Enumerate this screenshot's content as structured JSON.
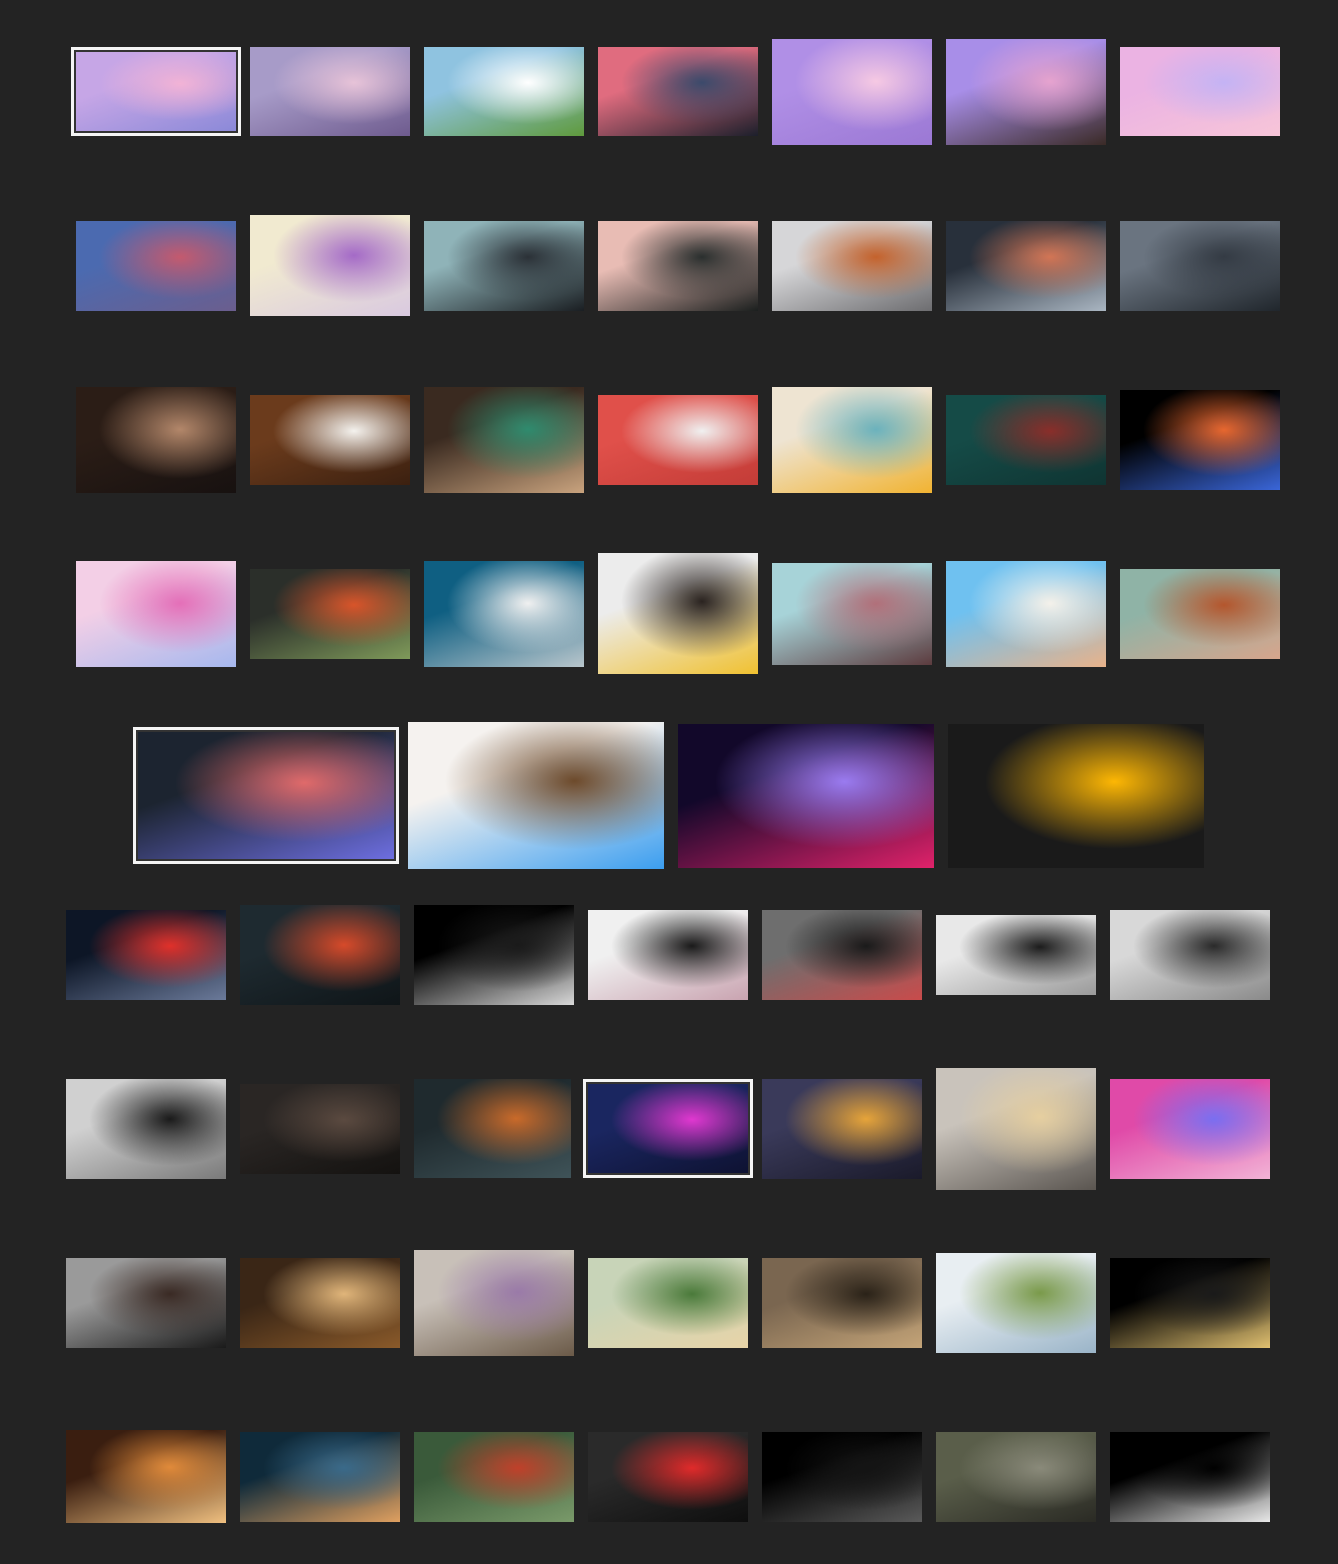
{
  "gallery": {
    "title": "",
    "rows": [
      {
        "thumbs": [
          {
            "name": "thumb-pastel-clouds-moon",
            "selected": true,
            "colors": [
              "#c6a6e6",
              "#f2b3d6",
              "#8b89d8"
            ]
          },
          {
            "name": "thumb-pink-cloudy-sky",
            "colors": [
              "#a79bc8",
              "#e7c3d8",
              "#6e5b8e"
            ]
          },
          {
            "name": "thumb-anime-cloud-hill",
            "colors": [
              "#8fc3e0",
              "#ffffff",
              "#5f9a3c"
            ]
          },
          {
            "name": "thumb-city-pink-sunset",
            "colors": [
              "#e06c7f",
              "#3b4a6b",
              "#1c1f2b"
            ]
          },
          {
            "name": "thumb-cherry-blossom",
            "colors": [
              "#b08fe6",
              "#f6c9e3",
              "#9b78d4"
            ]
          },
          {
            "name": "thumb-purple-dusk-mountain",
            "colors": [
              "#a88ee8",
              "#e6a3cf",
              "#3a2a26"
            ]
          },
          {
            "name": "thumb-cat-on-clouds",
            "colors": [
              "#ebb3e3",
              "#c4b3f4",
              "#f7c5d8"
            ]
          }
        ]
      },
      {
        "thumbs": [
          {
            "name": "thumb-train-station",
            "colors": [
              "#4b6ab0",
              "#c45a6e",
              "#6b5e8e"
            ]
          },
          {
            "name": "thumb-purple-mist-peak",
            "colors": [
              "#f1ead0",
              "#a46ac7",
              "#d9c9e0"
            ]
          },
          {
            "name": "thumb-dark-mountains-teal",
            "colors": [
              "#8fb3b8",
              "#2b3137",
              "#1a1e22"
            ]
          },
          {
            "name": "thumb-pink-sky-peak",
            "colors": [
              "#e8bcb4",
              "#2a2f2e",
              "#1b1f1e"
            ]
          },
          {
            "name": "thumb-orange-ridge-fog",
            "colors": [
              "#d6d6d8",
              "#c4622c",
              "#6d6d70"
            ]
          },
          {
            "name": "thumb-abstract-orange-shapes",
            "colors": [
              "#28303b",
              "#d27555",
              "#aab6c2"
            ]
          },
          {
            "name": "thumb-foggy-forest",
            "colors": [
              "#6a7480",
              "#343b44",
              "#20262c"
            ]
          }
        ]
      },
      {
        "thumbs": [
          {
            "name": "thumb-latte-art-dark",
            "colors": [
              "#2b1d16",
              "#b3876a",
              "#171110"
            ]
          },
          {
            "name": "thumb-coffee-beans-cup",
            "colors": [
              "#6b3b1c",
              "#f4f2ee",
              "#3b2010"
            ]
          },
          {
            "name": "thumb-green-cup-latte",
            "colors": [
              "#3a2a20",
              "#2f8b6e",
              "#c9a37e"
            ]
          },
          {
            "name": "thumb-red-wall-outlets",
            "colors": [
              "#e0504a",
              "#f0f0f0",
              "#c33c37"
            ]
          },
          {
            "name": "thumb-striped-building",
            "colors": [
              "#eee4d2",
              "#6bb2bd",
              "#f1b331"
            ]
          },
          {
            "name": "thumb-dalek",
            "colors": [
              "#154b47",
              "#8a2e2a",
              "#0f3432"
            ]
          },
          {
            "name": "thumb-liquid-swirl",
            "colors": [
              "#000000",
              "#e7672f",
              "#3a66d9"
            ]
          }
        ]
      },
      {
        "thumbs": [
          {
            "name": "thumb-pink-marble",
            "colors": [
              "#f3cfe6",
              "#e46fb8",
              "#a6b8ee"
            ]
          },
          {
            "name": "thumb-autumn-forest-lake",
            "colors": [
              "#2b2f2a",
              "#d8542a",
              "#7f9a5a"
            ]
          },
          {
            "name": "thumb-blue-sky-white-roof",
            "colors": [
              "#0f5f82",
              "#f0f0f0",
              "#b9c6cc"
            ]
          },
          {
            "name": "thumb-triangle-building",
            "colors": [
              "#ececec",
              "#2a2320",
              "#f0c130"
            ]
          },
          {
            "name": "thumb-pink-cubes-building",
            "colors": [
              "#a7d3d8",
              "#b1707a",
              "#5c3b3e"
            ]
          },
          {
            "name": "thumb-white-house-blue-sky",
            "colors": [
              "#6fc1f0",
              "#f4f1ea",
              "#e8b28a"
            ]
          },
          {
            "name": "thumb-orange-tower-up",
            "colors": [
              "#8fb3a6",
              "#b4562d",
              "#d7a58c"
            ]
          }
        ]
      },
      {
        "thumbs": [
          {
            "name": "thumb-neon-skeleton-logo",
            "selected": true,
            "colors": [
              "#1c2430",
              "#e06a6a",
              "#6d6ee0"
            ]
          },
          {
            "name": "thumb-anime-silver-hair-logo",
            "colors": [
              "#f5f2ef",
              "#6d4a2b",
              "#3b9ef0"
            ]
          },
          {
            "name": "thumb-purple-gradient-logo",
            "colors": [
              "#12082a",
              "#9a7bf0",
              "#e0226a"
            ]
          },
          {
            "name": "thumb-black-yellow-split",
            "colors": [
              "#1a1a1a",
              "#fdb704",
              "#1a1a1a"
            ]
          }
        ]
      },
      {
        "thumbs": [
          {
            "name": "thumb-darth-vader-saber",
            "colors": [
              "#0d1626",
              "#e0302a",
              "#6b7a9a"
            ]
          },
          {
            "name": "thumb-red-rings-abstract",
            "colors": [
              "#1e2a30",
              "#d64a2a",
              "#0f1518"
            ]
          },
          {
            "name": "thumb-black-bear-dark",
            "colors": [
              "#000000",
              "#1a1a1a",
              "#d8d8d8"
            ]
          },
          {
            "name": "thumb-anime-white-hair-girl",
            "colors": [
              "#f0f0f0",
              "#1a1a1a",
              "#c9a3b0"
            ]
          },
          {
            "name": "thumb-girl-red-symbols",
            "colors": [
              "#6e6e6e",
              "#1a1a1a",
              "#c94b4b"
            ]
          },
          {
            "name": "thumb-manga-pattern",
            "colors": [
              "#e8e8e8",
              "#1c1c1c",
              "#9a9a9a"
            ]
          },
          {
            "name": "thumb-silhouettes-fists",
            "colors": [
              "#d8d8d8",
              "#2a2a2a",
              "#8a8a8a"
            ]
          }
        ]
      },
      {
        "thumbs": [
          {
            "name": "thumb-bw-girl-fence",
            "colors": [
              "#d0d0d0",
              "#1a1a1a",
              "#7a7a7a"
            ]
          },
          {
            "name": "thumb-girl-with-rifle",
            "colors": [
              "#2a2624",
              "#5b4a40",
              "#141210"
            ]
          },
          {
            "name": "thumb-girl-smoking-cap",
            "colors": [
              "#1f2a2e",
              "#c96a2a",
              "#3f5358"
            ]
          },
          {
            "name": "thumb-neon-flower-girl",
            "selected": true,
            "colors": [
              "#1a2660",
              "#e038d0",
              "#0e1232"
            ]
          },
          {
            "name": "thumb-curly-hair-bokeh",
            "colors": [
              "#3a3a5a",
              "#e6a43a",
              "#1a1a2a"
            ]
          },
          {
            "name": "thumb-blonde-bob-girl",
            "colors": [
              "#c9c3bb",
              "#e6cfa0",
              "#5a5550"
            ]
          },
          {
            "name": "thumb-pink-painted-face",
            "colors": [
              "#e04aa8",
              "#7a6ef0",
              "#f2b3d6"
            ]
          }
        ]
      },
      {
        "thumbs": [
          {
            "name": "thumb-brunette-hands-up",
            "colors": [
              "#9a9a9a",
              "#3a2a24",
              "#1a1a1a"
            ]
          },
          {
            "name": "thumb-blonde-forest-girl",
            "colors": [
              "#3a2616",
              "#e0b57a",
              "#8a5a2a"
            ]
          },
          {
            "name": "thumb-girl-lavender-field",
            "colors": [
              "#c8c0b8",
              "#9a7aa8",
              "#6b5a48"
            ]
          },
          {
            "name": "thumb-girl-green-valley",
            "colors": [
              "#c8d4b8",
              "#4a7a3a",
              "#e8d4a8"
            ]
          },
          {
            "name": "thumb-girl-profile-brown",
            "colors": [
              "#7a6650",
              "#2a2218",
              "#c4a478"
            ]
          },
          {
            "name": "thumb-yeti-octopus",
            "colors": [
              "#e8eef2",
              "#7a9a4a",
              "#9ab4c8"
            ]
          },
          {
            "name": "thumb-black-cat-whiskers",
            "colors": [
              "#000000",
              "#1a1a1a",
              "#e0c070"
            ]
          }
        ]
      },
      {
        "thumbs": [
          {
            "name": "thumb-anime-stairs-warm",
            "colors": [
              "#3a1e10",
              "#e08a3a",
              "#f0c080"
            ]
          },
          {
            "name": "thumb-retro-city-art",
            "colors": [
              "#0f2a3a",
              "#3a6a8a",
              "#e0a060"
            ]
          },
          {
            "name": "thumb-jungle-characters",
            "colors": [
              "#3a5a3a",
              "#c0402a",
              "#7a9a6a"
            ]
          },
          {
            "name": "thumb-masked-demon-girl",
            "colors": [
              "#2a2a2a",
              "#e02a2a",
              "#0e0e0e"
            ]
          },
          {
            "name": "thumb-black-cat-dark",
            "colors": [
              "#000000",
              "#141414",
              "#5a5a5a"
            ]
          },
          {
            "name": "thumb-anime-store-girl",
            "colors": [
              "#5a5e4a",
              "#8a8a7a",
              "#2a2a24"
            ]
          },
          {
            "name": "thumb-black-small-figure",
            "colors": [
              "#000000",
              "#000000",
              "#e8e8e8"
            ]
          }
        ]
      }
    ]
  }
}
